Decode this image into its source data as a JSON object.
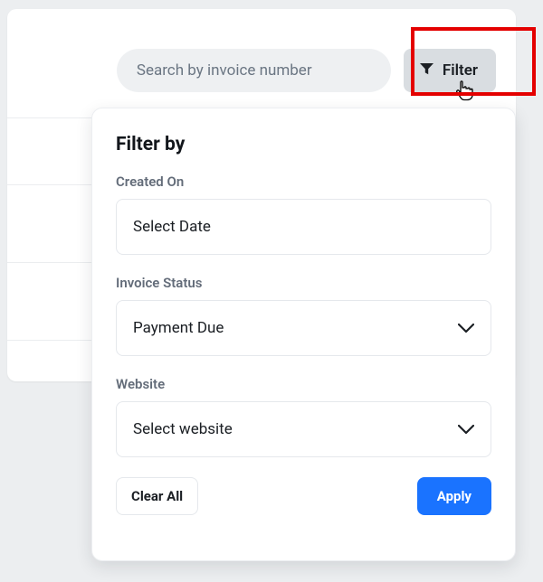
{
  "toolbar": {
    "search_placeholder": "Search by invoice number",
    "filter_label": "Filter"
  },
  "panel": {
    "title": "Filter by",
    "fields": {
      "created_on": {
        "label": "Created On",
        "value": "Select Date"
      },
      "invoice_status": {
        "label": "Invoice Status",
        "value": "Payment Due"
      },
      "website": {
        "label": "Website",
        "value": "Select website"
      }
    },
    "actions": {
      "clear_all": "Clear All",
      "apply": "Apply"
    }
  },
  "colors": {
    "primary": "#1a73ff",
    "highlight": "#e40000"
  }
}
